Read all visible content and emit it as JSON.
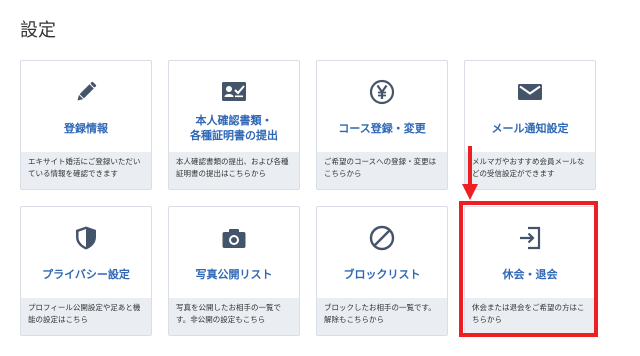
{
  "page": {
    "title": "設定"
  },
  "colors": {
    "accent": "#2f68b6",
    "icon": "#44546a",
    "card_border": "#d9dee6",
    "desc_bg": "#eaeef3",
    "highlight": "#ee1f23"
  },
  "cards": [
    {
      "title": "登録情報",
      "title_line2": "",
      "description": "エキサイト婚活にご登録いただいている情報を確認できます",
      "icon": "pencil-icon"
    },
    {
      "title": "本人確認書類・",
      "title_line2": "各種証明書の提出",
      "description": "本人確認書類の提出、および各種証明書の提出はこちらから",
      "icon": "id-card-check-icon"
    },
    {
      "title": "コース登録・変更",
      "title_line2": "",
      "description": "ご希望のコースへの登録・変更はこちらから",
      "icon": "yen-circle-icon"
    },
    {
      "title": "メール通知設定",
      "title_line2": "",
      "description": "メルマガやおすすめ会員メールなどの受信設定ができます",
      "icon": "envelope-icon"
    },
    {
      "title": "プライバシー設定",
      "title_line2": "",
      "description": "プロフィール公開設定や足あと機能の設定はこちら",
      "icon": "shield-icon"
    },
    {
      "title": "写真公開リスト",
      "title_line2": "",
      "description": "写真を公開したお相手の一覧です。非公開の設定もこちら",
      "icon": "camera-icon"
    },
    {
      "title": "ブロックリスト",
      "title_line2": "",
      "description": "ブロックしたお相手の一覧です。解除もこちらから",
      "icon": "block-icon"
    },
    {
      "title": "休会・退会",
      "title_line2": "",
      "description": "休会または退会をご希望の方はこちらから",
      "icon": "sign-in-arrow-icon"
    }
  ]
}
